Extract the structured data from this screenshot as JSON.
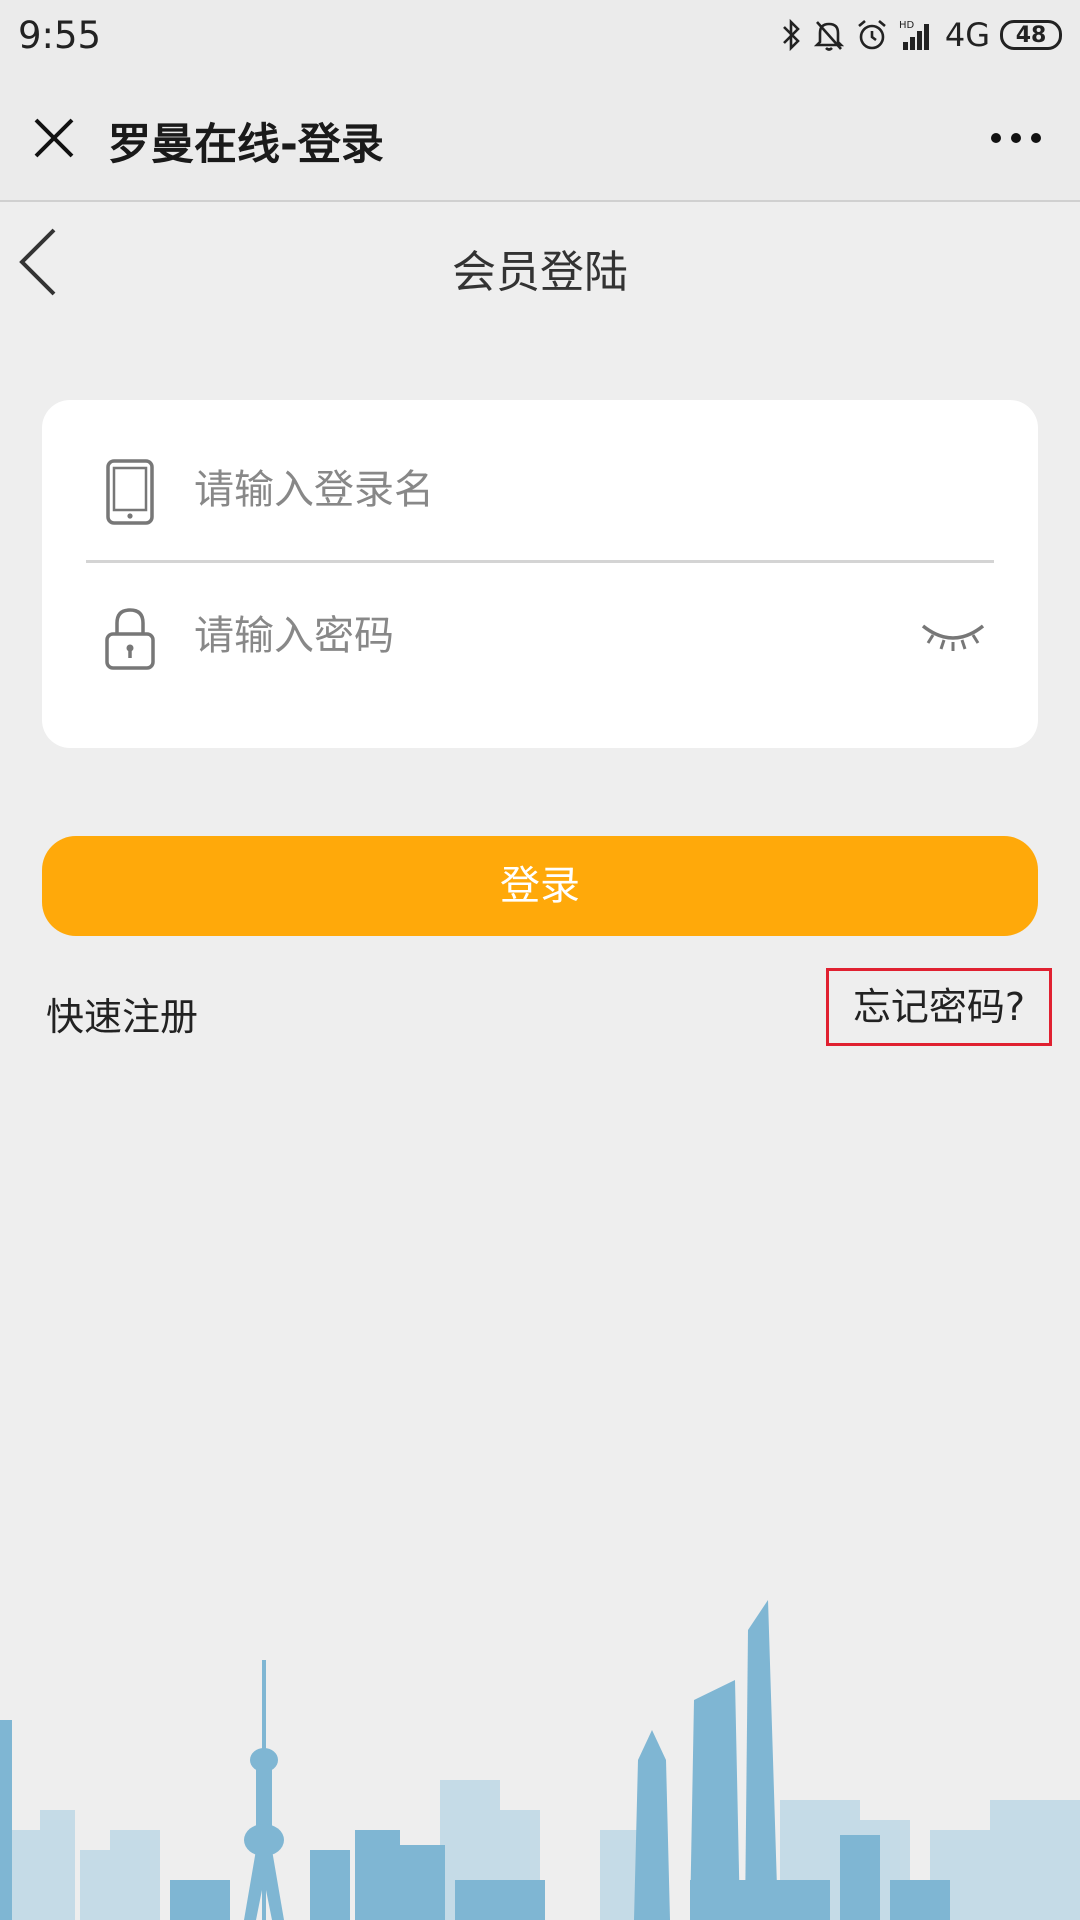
{
  "status_bar": {
    "time": "9:55",
    "network": "4G",
    "battery": "48",
    "icons": [
      "bluetooth-icon",
      "mute-bell-icon",
      "alarm-icon",
      "signal-icon"
    ]
  },
  "nav": {
    "title": "罗曼在线-登录",
    "close_icon": "close-icon",
    "more_icon": "more-icon"
  },
  "page": {
    "title": "会员登陆"
  },
  "form": {
    "username_placeholder": "请输入登录名",
    "username_value": "",
    "password_placeholder": "请输入密码",
    "password_value": ""
  },
  "actions": {
    "login_label": "登录",
    "register_label": "快速注册",
    "forgot_label": "忘记密码?"
  },
  "colors": {
    "accent": "#ffa90a",
    "highlight_border": "#e02030",
    "skyline": "#8ec3de"
  }
}
